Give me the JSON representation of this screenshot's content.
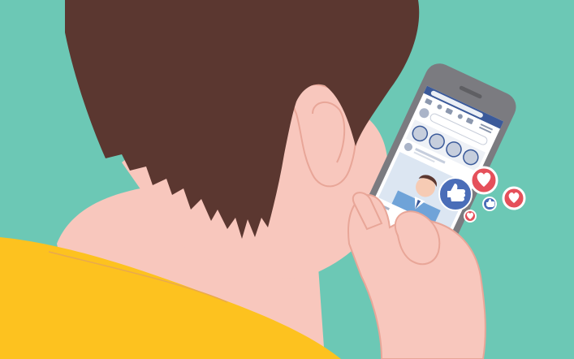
{
  "scene": {
    "description_icons": {
      "reactions": [
        "heart-icon",
        "like-thumb-icon"
      ]
    },
    "colors": {
      "background": "#6CC8B5",
      "hair": "#5B3730",
      "skin": "#F8C7BD",
      "skin_line": "#E8A698",
      "shirt": "#FDC21F",
      "phone_body": "#7B7B80",
      "phone_screen": "#FFFFFF",
      "app_header": "#3B5A9A",
      "like_blue": "#4A6DB8",
      "heart_red": "#E5505A"
    }
  }
}
